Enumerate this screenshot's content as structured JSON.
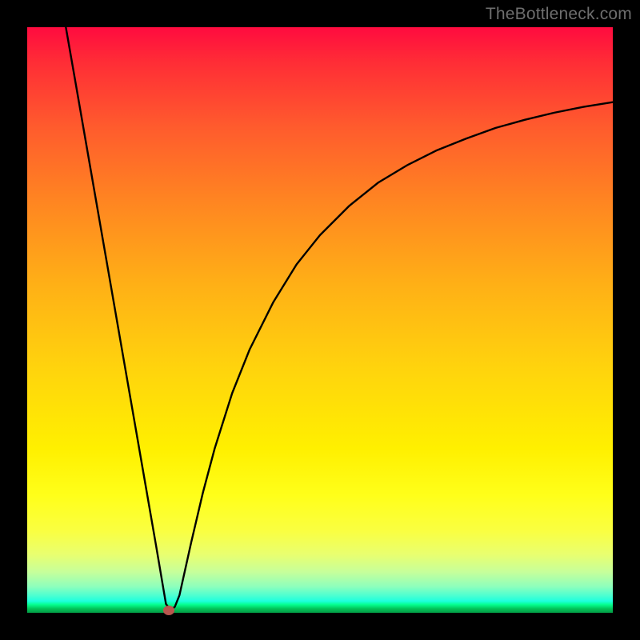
{
  "watermark": "TheBottleneck.com",
  "chart_data": {
    "type": "line",
    "title": "",
    "xlabel": "",
    "ylabel": "",
    "xlim": [
      0,
      100
    ],
    "ylim": [
      0,
      100
    ],
    "grid": false,
    "legend": false,
    "background_gradient_stops": [
      {
        "pct": 0,
        "color": "#ff0b3f"
      },
      {
        "pct": 6,
        "color": "#ff2d36"
      },
      {
        "pct": 17,
        "color": "#ff5b2d"
      },
      {
        "pct": 30,
        "color": "#ff8621"
      },
      {
        "pct": 44,
        "color": "#ffb016"
      },
      {
        "pct": 58,
        "color": "#ffd30d"
      },
      {
        "pct": 72,
        "color": "#fff000"
      },
      {
        "pct": 80,
        "color": "#ffff1a"
      },
      {
        "pct": 86,
        "color": "#faff41"
      },
      {
        "pct": 90,
        "color": "#e9ff6f"
      },
      {
        "pct": 93,
        "color": "#c7ff9a"
      },
      {
        "pct": 95.5,
        "color": "#8effbc"
      },
      {
        "pct": 97,
        "color": "#4fffd0"
      },
      {
        "pct": 98,
        "color": "#1fffdd"
      },
      {
        "pct": 98.6,
        "color": "#04ff90"
      },
      {
        "pct": 99.3,
        "color": "#03c45a"
      },
      {
        "pct": 100,
        "color": "#039b45"
      }
    ],
    "series": [
      {
        "name": "bottleneck-curve",
        "stroke": "#000000",
        "x": [
          6.6,
          8,
          10,
          12,
          14,
          16,
          18,
          20,
          22,
          23.7,
          24.5,
          25.2,
          26,
          27,
          28,
          30,
          32,
          35,
          38,
          42,
          46,
          50,
          55,
          60,
          65,
          70,
          75,
          80,
          85,
          90,
          95,
          100
        ],
        "y": [
          100,
          92,
          80.5,
          69,
          57.5,
          46,
          34.5,
          23,
          11.5,
          1.5,
          0.5,
          1,
          3,
          7.5,
          12,
          20.5,
          28,
          37.5,
          45,
          53,
          59.5,
          64.5,
          69.5,
          73.5,
          76.5,
          79,
          81,
          82.8,
          84.2,
          85.4,
          86.4,
          87.2
        ]
      }
    ],
    "marker": {
      "x": 24.2,
      "y": 0.4,
      "color": "#b9564e"
    }
  }
}
